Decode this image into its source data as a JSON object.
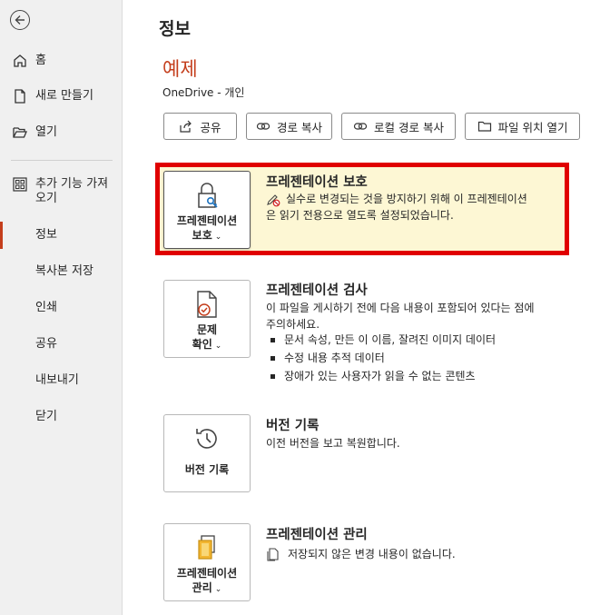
{
  "sidebar": {
    "items": [
      {
        "label": "홈",
        "icon": "home-icon"
      },
      {
        "label": "새로 만들기",
        "icon": "new-document-icon"
      },
      {
        "label": "열기",
        "icon": "open-folder-icon"
      },
      {
        "label": "추가 기능 가져오기",
        "icon": "add-ins-grid-icon"
      },
      {
        "label": "정보"
      },
      {
        "label": "복사본 저장"
      },
      {
        "label": "인쇄"
      },
      {
        "label": "공유"
      },
      {
        "label": "내보내기"
      },
      {
        "label": "닫기"
      }
    ],
    "addins_line1": "추가 기능 가져",
    "addins_line2": "오기"
  },
  "header": {
    "page_title": "정보",
    "doc_title": "예제",
    "doc_location": "OneDrive - 개인"
  },
  "toolbar": {
    "share": "공유",
    "copy_path": "경로 복사",
    "copy_local_path": "로컬 경로 복사",
    "open_file_location": "파일 위치 열기"
  },
  "sections": {
    "protect": {
      "button_line1": "프레젠테이션",
      "button_line2": "보호",
      "title": "프레젠테이션 보호",
      "desc_line1": "실수로 변경되는 것을 방지하기 위해 이 프레젠테이션",
      "desc_line2": "은 읽기 전용으로 열도록 설정되었습니다."
    },
    "inspect": {
      "button_line1": "문제",
      "button_line2": "확인",
      "title": "프레젠테이션 검사",
      "desc_line1": "이 파일을 게시하기 전에 다음 내용이 포함되어 있다는 점에",
      "desc_line2": "주의하세요.",
      "bullets": [
        "문서 속성, 만든 이 이름, 잘려진 이미지 데이터",
        "수정 내용 추적 데이터",
        "장애가 있는 사용자가 읽을 수 없는 콘텐츠"
      ]
    },
    "history": {
      "button_label": "버전 기록",
      "title": "버전 기록",
      "desc": "이전 버전을 보고 복원합니다."
    },
    "manage": {
      "button_line1": "프레젠테이션",
      "button_line2": "관리",
      "title": "프레젠테이션 관리",
      "desc": "저장되지 않은 변경 내용이 없습니다."
    }
  },
  "colors": {
    "accent": "#c43e1c",
    "highlight_border": "#e00000",
    "highlight_bg": "#fdf7d4"
  }
}
